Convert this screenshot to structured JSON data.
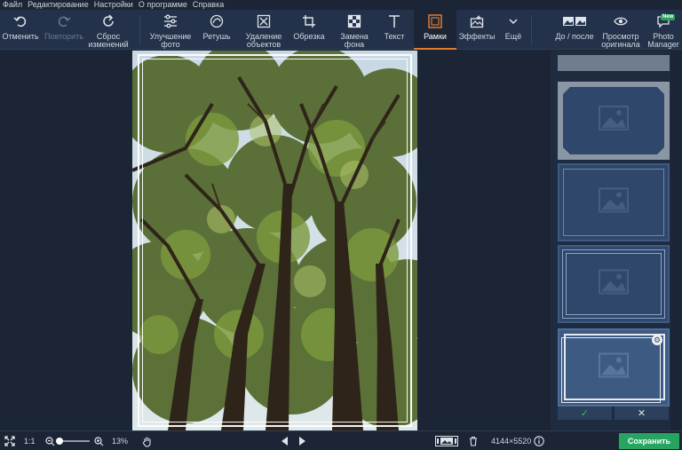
{
  "menu": [
    "Файл",
    "Редактирование",
    "Настройки",
    "О программе",
    "Справка"
  ],
  "toolbar": {
    "undo": "Отменить",
    "redo": "Повторить",
    "reset": "Сброс\nизменений",
    "enhance": "Улучшение\nфото",
    "retouch": "Ретушь",
    "object_removal": "Удаление\nобъектов",
    "crop": "Обрезка",
    "bg_replace": "Замена\nфона",
    "text": "Текст",
    "frames": "Рамки",
    "effects": "Эффекты",
    "more": "Ещё",
    "before_after": "До / после",
    "view_original": "Просмотр\nоригинала",
    "photo_manager": "Photo\nManager",
    "new_badge": "New"
  },
  "bottombar": {
    "ratio": "1:1",
    "zoom": "13%",
    "dimensions": "4144×5520",
    "save": "Сохранить"
  },
  "colors": {
    "accent_active": "#e07a2e",
    "save_green": "#27a560",
    "toolbar_bg": "#23324a",
    "app_bg": "#1b2535"
  }
}
